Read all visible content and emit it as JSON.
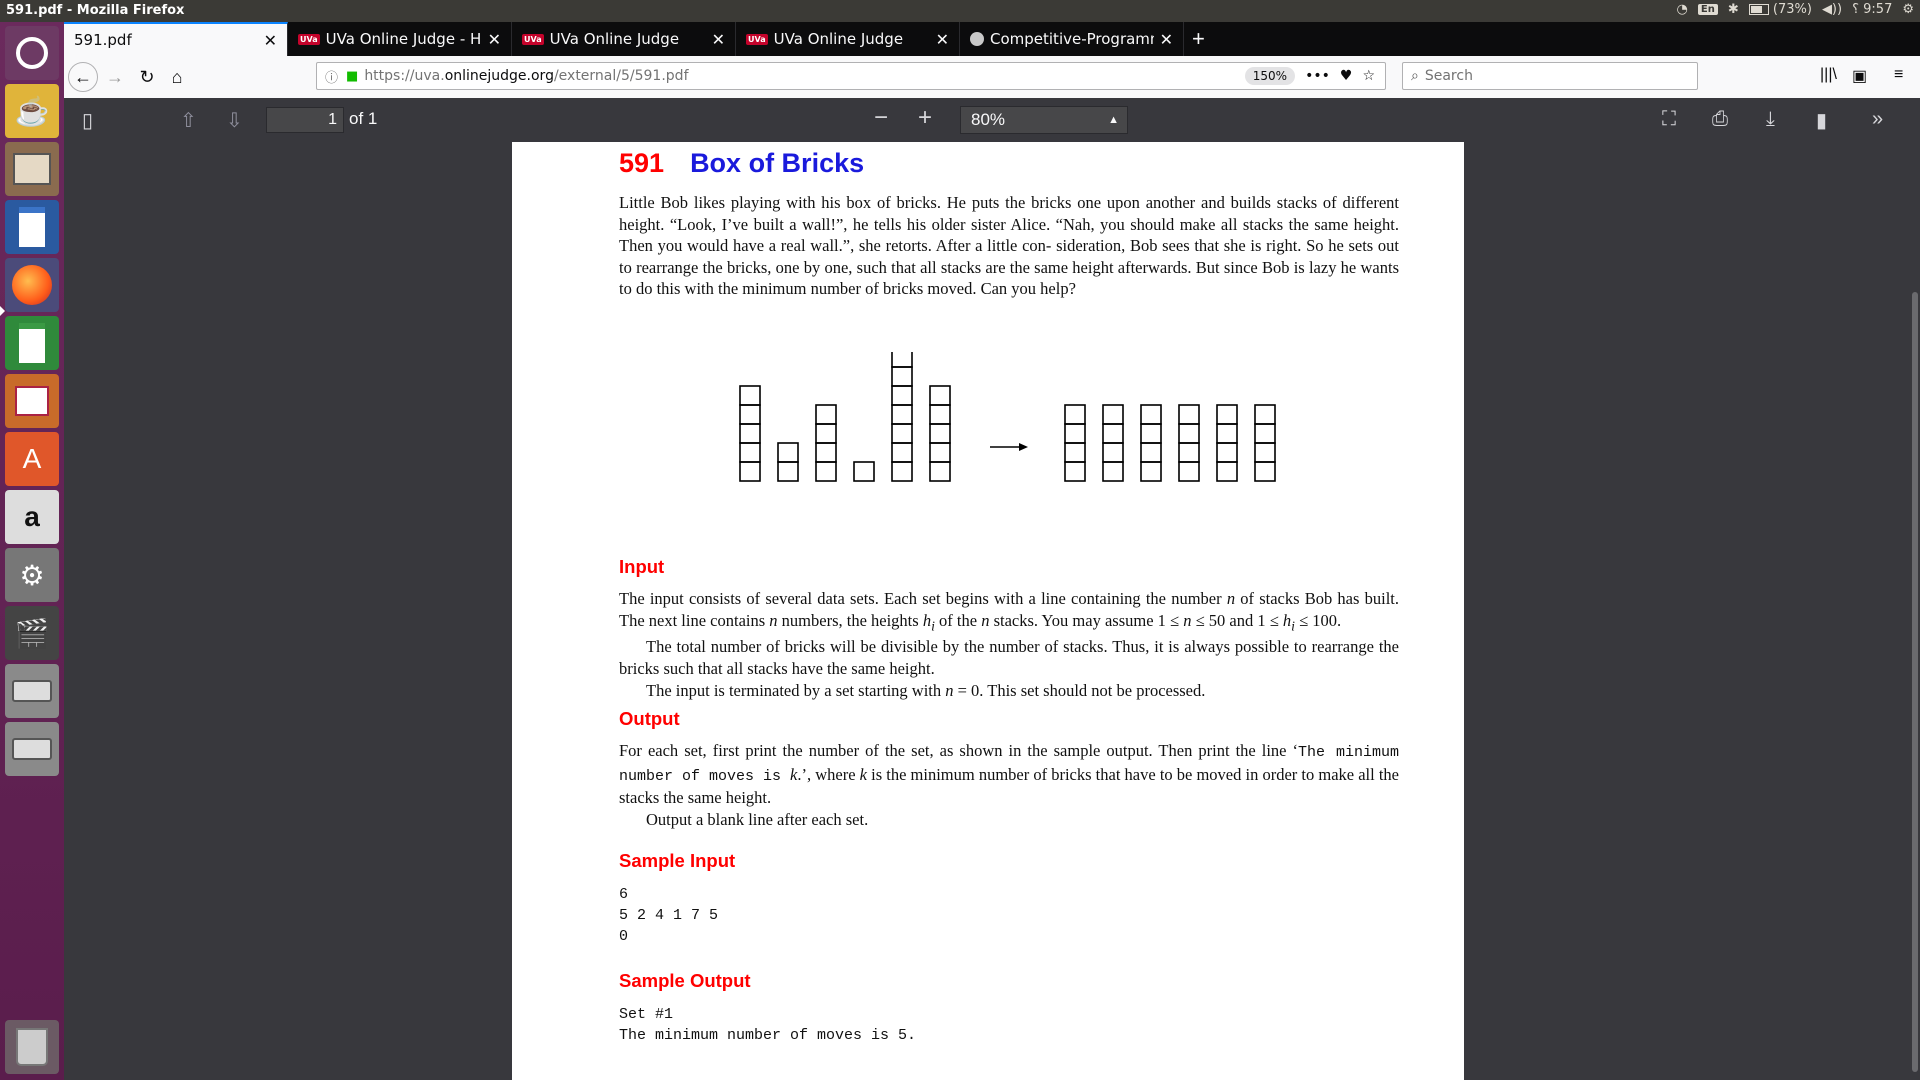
{
  "system": {
    "window_title": "591.pdf - Mozilla Firefox",
    "keyboard": "En",
    "battery": "(73%)",
    "time": "9:57"
  },
  "tabs": [
    {
      "label": "591.pdf",
      "active": true,
      "icon": "none"
    },
    {
      "label": "UVa Online Judge - Hom",
      "active": false,
      "icon": "uva-icon"
    },
    {
      "label": "UVa Online Judge",
      "active": false,
      "icon": "uva-icon"
    },
    {
      "label": "UVa Online Judge",
      "active": false,
      "icon": "uva-icon"
    },
    {
      "label": "Competitive-Programm",
      "active": false,
      "icon": "github-icon"
    }
  ],
  "uva_badge": "UVa",
  "navbar": {
    "url_prefix": "https://uva.",
    "url_domain": "onlinejudge.org",
    "url_suffix": "/external/5/591.pdf",
    "zoom": "150%",
    "search_placeholder": "Search"
  },
  "pdf_toolbar": {
    "page_number": "1",
    "page_count": "of 1",
    "zoom": "80%"
  },
  "document": {
    "problem_number": "591",
    "problem_title": "Box of Bricks",
    "intro": "Little Bob likes playing with his box of bricks. He puts the bricks one upon another and builds stacks of different height. “Look, I’ve built a wall!”, he tells his older sister Alice. “Nah, you should make all stacks the same height. Then you would have a real wall.”, she retorts. After a little con- sideration, Bob sees that she is right. So he sets out to rearrange the bricks, one by one, such that all stacks are the same height afterwards. But since Bob is lazy he wants to do this with the minimum number of bricks moved. Can you help?",
    "figure": {
      "before_heights": [
        5,
        2,
        4,
        1,
        7,
        5
      ],
      "after_heights": [
        4,
        4,
        4,
        4,
        4,
        4
      ]
    },
    "input_heading": "Input",
    "input_p1_a": "The input consists of several data sets. Each set begins with a line containing the number ",
    "input_p1_b": " of stacks Bob has built. The next line contains ",
    "input_p1_c": " numbers, the heights ",
    "input_p1_d": " of the ",
    "input_p1_e": " stacks. You may assume ",
    "input_p1_f": "1 ≤ ",
    "input_p1_g": " ≤ 50 and 1 ≤ ",
    "input_p1_h": " ≤ 100.",
    "var_n": "n",
    "var_h": "h",
    "var_i": "i",
    "var_k": "k",
    "input_p2": "The total number of bricks will be divisible by the number of stacks. Thus, it is always possible to rearrange the bricks such that all stacks have the same height.",
    "input_p3_a": "The input is terminated by a set starting with ",
    "input_p3_b": " = 0. This set should not be processed.",
    "output_heading": "Output",
    "output_p1_a": "For each set, first print the number of the set, as shown in the sample output. Then print the line ‘",
    "output_p1_mono": "The minimum number of moves is ",
    "output_p1_b": ".’, where ",
    "output_p1_c": " is the minimum number of bricks that have to be moved in order to make all the stacks the same height.",
    "output_p2": "Output a blank line after each set.",
    "sample_input_heading": "Sample Input",
    "sample_input": "6\n5 2 4 1 7 5\n0",
    "sample_output_heading": "Sample Output",
    "sample_output": "Set #1\nThe minimum number of moves is 5."
  }
}
